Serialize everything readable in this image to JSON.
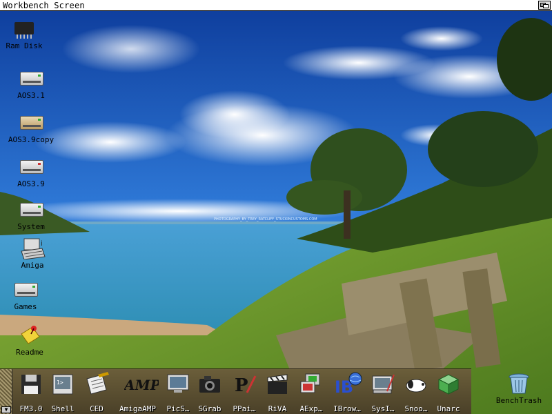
{
  "screen": {
    "title": "Workbench Screen"
  },
  "desktop": {
    "icons": [
      {
        "id": "ramdisk",
        "label": "Ram Disk",
        "icon": "ram-chip-icon"
      },
      {
        "id": "aos31",
        "label": "AOS3.1",
        "icon": "hard-drive-icon"
      },
      {
        "id": "aos39copy",
        "label": "AOS3.9copy",
        "icon": "hard-drive-icon"
      },
      {
        "id": "aos39",
        "label": "AOS3.9",
        "icon": "hard-drive-icon"
      },
      {
        "id": "system",
        "label": "System",
        "icon": "hard-drive-icon"
      },
      {
        "id": "amiga",
        "label": "Amiga",
        "icon": "keyboard-drive-icon"
      },
      {
        "id": "games",
        "label": "Games",
        "icon": "hard-drive-icon"
      },
      {
        "id": "readme",
        "label": "Readme",
        "icon": "note-icon"
      }
    ],
    "trash": {
      "label": "BenchTrash",
      "icon": "trash-icon"
    },
    "wallpaper_watermark": "PHOTOGRAPHY_BY_TREY_RATCLIFF_STUCKINCUSTOMS.COM"
  },
  "dock": {
    "items": [
      {
        "label": "FM3.0",
        "icon": "floppy-icon"
      },
      {
        "label": "Shell",
        "icon": "shell-icon"
      },
      {
        "label": "CED",
        "icon": "editor-icon"
      },
      {
        "label": "AmigaAMP",
        "icon": "amp-icon"
      },
      {
        "label": "PicS…",
        "icon": "monitor-icon"
      },
      {
        "label": "SGrab",
        "icon": "camera-icon"
      },
      {
        "label": "PPai…",
        "icon": "paint-icon"
      },
      {
        "label": "RiVA",
        "icon": "clapper-icon"
      },
      {
        "label": "AExp…",
        "icon": "explorer-icon"
      },
      {
        "label": "IBrow…",
        "icon": "browser-icon"
      },
      {
        "label": "SysI…",
        "icon": "sysinfo-icon"
      },
      {
        "label": "Snoo…",
        "icon": "snoopy-icon"
      },
      {
        "label": "Unarc",
        "icon": "archive-cube-icon"
      }
    ]
  },
  "colors": {
    "sky": "#1d5fc4",
    "sea": "#3c9fd8",
    "grass": "#6e9a2a",
    "dock": "#5a4e32"
  }
}
